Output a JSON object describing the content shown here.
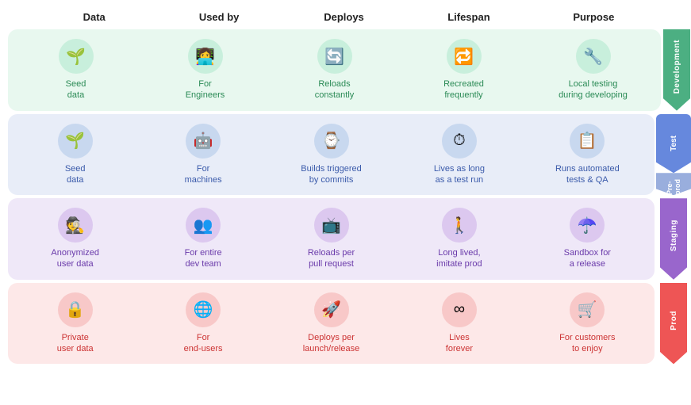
{
  "headers": [
    "Data",
    "Used by",
    "Deploys",
    "Lifespan",
    "Purpose"
  ],
  "environments": [
    {
      "id": "dev",
      "label": "Development",
      "colorClass": "dev",
      "cells": [
        {
          "icon": "🌱",
          "text": "Seed\ndata"
        },
        {
          "icon": "👩‍💻",
          "text": "For\nEngineers"
        },
        {
          "icon": "🔄",
          "text": "Reloads\nconstantly"
        },
        {
          "icon": "🔁",
          "text": "Recreated\nfrequently"
        },
        {
          "icon": "🔧",
          "text": "Local testing\nduring developing"
        }
      ]
    },
    {
      "id": "test",
      "label": "Pre-prod",
      "sublabel": "Test",
      "colorClass": "test",
      "cells": [
        {
          "icon": "🌱",
          "text": "Seed\ndata"
        },
        {
          "icon": "🤖",
          "text": "For\nmachines"
        },
        {
          "icon": "⌚",
          "text": "Builds triggered\nby commits"
        },
        {
          "icon": "⏱",
          "text": "Lives as long\nas a test run"
        },
        {
          "icon": "📋",
          "text": "Runs automated\ntests & QA"
        }
      ]
    },
    {
      "id": "staging",
      "label": "Staging",
      "colorClass": "staging",
      "cells": [
        {
          "icon": "🕵️",
          "text": "Anonymized\nuser data"
        },
        {
          "icon": "👥",
          "text": "For entire\ndev team"
        },
        {
          "icon": "📺",
          "text": "Reloads per\npull request"
        },
        {
          "icon": "🚶",
          "text": "Long lived,\nimitate prod"
        },
        {
          "icon": "☂️",
          "text": "Sandbox for\na release"
        }
      ]
    },
    {
      "id": "prod",
      "label": "Prod",
      "colorClass": "prod",
      "cells": [
        {
          "icon": "🔒",
          "text": "Private\nuser data"
        },
        {
          "icon": "🌐",
          "text": "For\nend-users"
        },
        {
          "icon": "🚀",
          "text": "Deploys per\nlaunch/release"
        },
        {
          "icon": "∞",
          "text": "Lives\nforever"
        },
        {
          "icon": "🛒",
          "text": "For customers\nto enjoy"
        }
      ]
    }
  ]
}
